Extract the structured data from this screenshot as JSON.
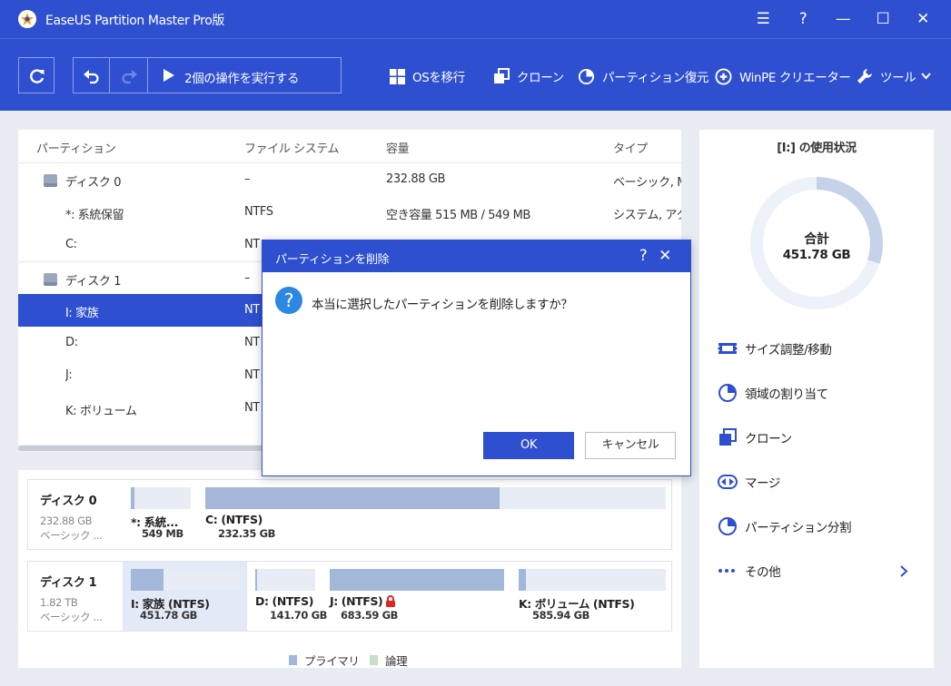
{
  "app": {
    "title": "EaseUS Partition Master Pro版"
  },
  "window_controls": {
    "menu": "☰",
    "help": "?",
    "minimize": "—",
    "maximize": "☐",
    "close": "✕"
  },
  "toolbar": {
    "execute_label": "2個の操作を実行する",
    "items": [
      {
        "label": "OSを移行",
        "icon": "windows-icon"
      },
      {
        "label": "クローン",
        "icon": "clone-icon"
      },
      {
        "label": "パーティション復元",
        "icon": "pie-icon"
      },
      {
        "label": "WinPE クリエーター",
        "icon": "plus-circle-icon"
      },
      {
        "label": "ツール",
        "icon": "wrench-icon"
      }
    ]
  },
  "partition_list": {
    "columns": [
      "パーティション",
      "ファイル システム",
      "容量",
      "タイプ"
    ],
    "rows": [
      {
        "name": "ディスク 0",
        "fs": "–",
        "capacity": "232.88 GB",
        "type": "ベーシック, MB",
        "is_disk": true
      },
      {
        "name": "*: 系統保留",
        "fs": "NTFS",
        "capacity": "空き容量 515 MB / 549 MB",
        "type": "システム, アク"
      },
      {
        "name": "C:",
        "fs": "NT",
        "capacity": "",
        "type": ""
      },
      {
        "name": "ディスク 1",
        "fs": "–",
        "capacity": "",
        "type": "",
        "is_disk": true
      },
      {
        "name": "I: 家族",
        "fs": "NT",
        "capacity": "",
        "type": "",
        "selected": true
      },
      {
        "name": "D:",
        "fs": "NT",
        "capacity": "",
        "type": ""
      },
      {
        "name": "J:",
        "fs": "NT",
        "capacity": "",
        "type": ""
      },
      {
        "name": "K: ボリューム",
        "fs": "NT",
        "capacity": "",
        "type": ""
      }
    ]
  },
  "disk_map": {
    "disks": [
      {
        "name": "ディスク 0",
        "size": "232.88 GB",
        "kind": "ベーシック ...",
        "partitions": [
          {
            "name": "*: 系統...",
            "size": "549 MB",
            "used_fraction": 0.06
          },
          {
            "name": "C: (NTFS)",
            "size": "232.35 GB",
            "used_fraction": 0.64
          }
        ]
      },
      {
        "name": "ディスク 1",
        "size": "1.82 TB",
        "kind": "ベーシック ...",
        "partitions": [
          {
            "name": "I: 家族 (NTFS)",
            "size": "451.78 GB",
            "used_fraction": 0.3,
            "selected": true
          },
          {
            "name": "D: (NTFS)",
            "size": "141.70 GB",
            "used_fraction": 0.03
          },
          {
            "name": "J: (NTFS)",
            "size": "683.59 GB",
            "used_fraction": 1.0,
            "locked": true
          },
          {
            "name": "K: ボリューム (NTFS)",
            "size": "585.94 GB",
            "used_fraction": 0.05
          }
        ]
      }
    ],
    "legend": [
      {
        "label": "プライマリ",
        "color": "#a3b7d9"
      },
      {
        "label": "論理",
        "color": "#c8dcc8"
      }
    ]
  },
  "usage": {
    "title": "[I:] の使用状況",
    "total_label": "合計",
    "total_value": "451.78 GB",
    "used_fraction": 0.3
  },
  "actions": [
    {
      "label": "サイズ調整/移動",
      "icon": "resize-icon"
    },
    {
      "label": "領域の割り当て",
      "icon": "pie-icon"
    },
    {
      "label": "クローン",
      "icon": "clone-icon"
    },
    {
      "label": "マージ",
      "icon": "merge-icon"
    },
    {
      "label": "パーティション分割",
      "icon": "pie-icon"
    },
    {
      "label": "その他",
      "icon": "more-icon"
    }
  ],
  "dialog": {
    "title": "パーティションを削除",
    "message": "本当に選択したパーティションを削除しますか？",
    "ok_label": "OK",
    "cancel_label": "キャンセル",
    "help": "?",
    "close": "✕"
  },
  "colors": {
    "brand": "#2e4fcf",
    "primary_partition": "#a3b7d9",
    "info": "#2d87e3"
  }
}
